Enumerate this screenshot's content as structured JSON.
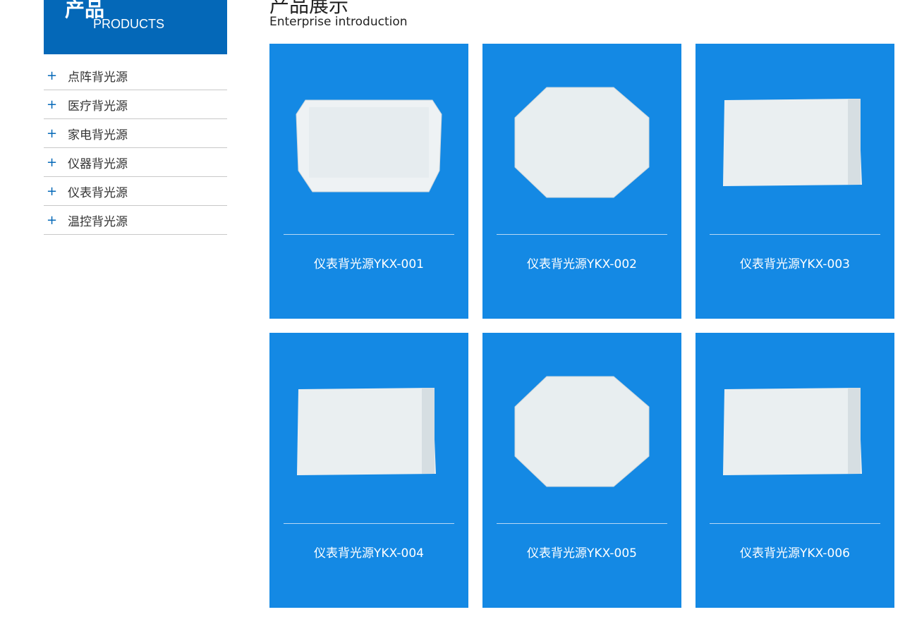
{
  "sidebar": {
    "title_cn": "产品",
    "title_en": "PRODUCTS",
    "items": [
      {
        "label": "点阵背光源"
      },
      {
        "label": "医疗背光源"
      },
      {
        "label": "家电背光源"
      },
      {
        "label": "仪器背光源"
      },
      {
        "label": "仪表背光源"
      },
      {
        "label": "温控背光源"
      }
    ]
  },
  "main": {
    "title": "产品展示",
    "subtitle": "Enterprise introduction",
    "products": [
      {
        "name": "仪表背光源YKX-001",
        "shape": "rect-tabs"
      },
      {
        "name": "仪表背光源YKX-002",
        "shape": "octagon"
      },
      {
        "name": "仪表背光源YKX-003",
        "shape": "rect"
      },
      {
        "name": "仪表背光源YKX-004",
        "shape": "rect"
      },
      {
        "name": "仪表背光源YKX-005",
        "shape": "octagon"
      },
      {
        "name": "仪表背光源YKX-006",
        "shape": "rect"
      }
    ]
  },
  "colors": {
    "card": "#1489e4",
    "sidebar_header": "#0468b8"
  }
}
